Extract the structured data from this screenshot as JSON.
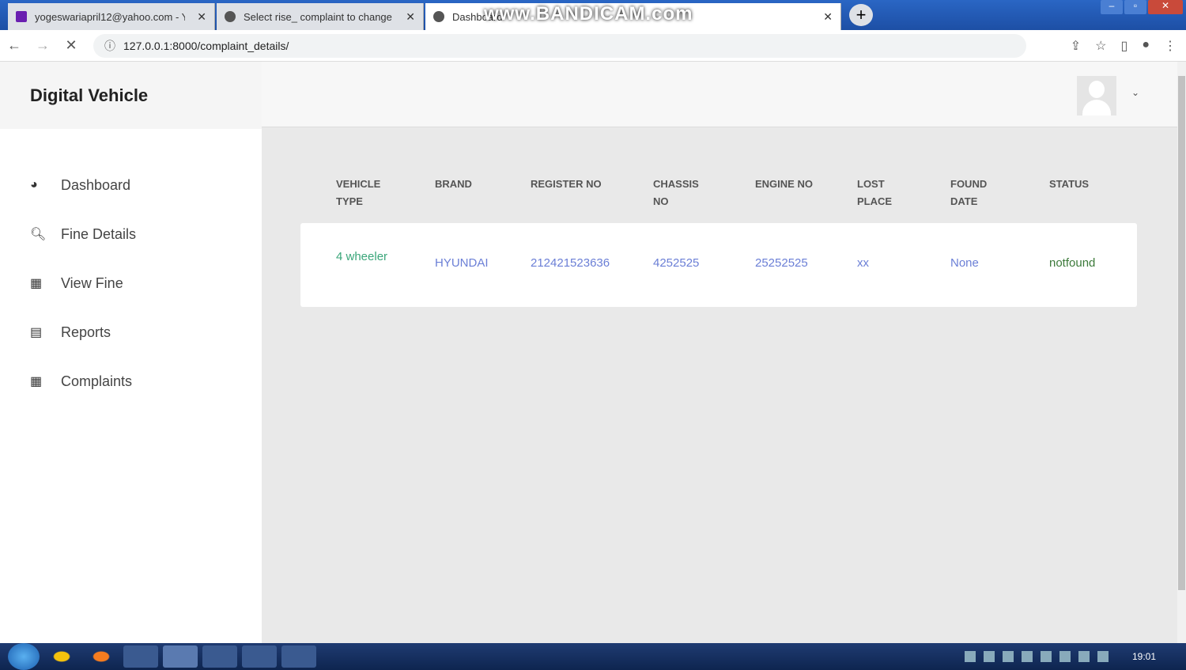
{
  "browser": {
    "tabs": [
      {
        "title": "yogeswariapril12@yahoo.com - Y",
        "icon": "mail-icon"
      },
      {
        "title": "Select rise_ complaint to change",
        "icon": "globe-icon"
      },
      {
        "title": "Dashboard",
        "icon": "globe-icon"
      }
    ],
    "watermark": "www.BANDICAM.com",
    "url": "127.0.0.1:8000/complaint_details/"
  },
  "sidebar": {
    "brand": "Digital Vehicle",
    "items": [
      {
        "label": "Dashboard",
        "icon": "dashboard-icon"
      },
      {
        "label": "Fine Details",
        "icon": "search-icon"
      },
      {
        "label": "View Fine",
        "icon": "table-icon"
      },
      {
        "label": "Reports",
        "icon": "book-icon"
      },
      {
        "label": "Complaints",
        "icon": "table-icon"
      }
    ]
  },
  "table": {
    "headers": [
      "VEHICLE TYPE",
      "BRAND",
      "REGISTER NO",
      "CHASSIS NO",
      "ENGINE NO",
      "LOST PLACE",
      "FOUND DATE",
      "STATUS"
    ],
    "rows": [
      [
        "4 wheeler",
        "HYUNDAI",
        "212421523636",
        "4252525",
        "25252525",
        "xx",
        "None",
        "notfound"
      ]
    ]
  },
  "colors": {
    "vehicle_type": "#3aa67a",
    "link": "#6b7fd6",
    "status": "#3c7a3a"
  },
  "taskbar": {
    "clock": "19:01"
  }
}
